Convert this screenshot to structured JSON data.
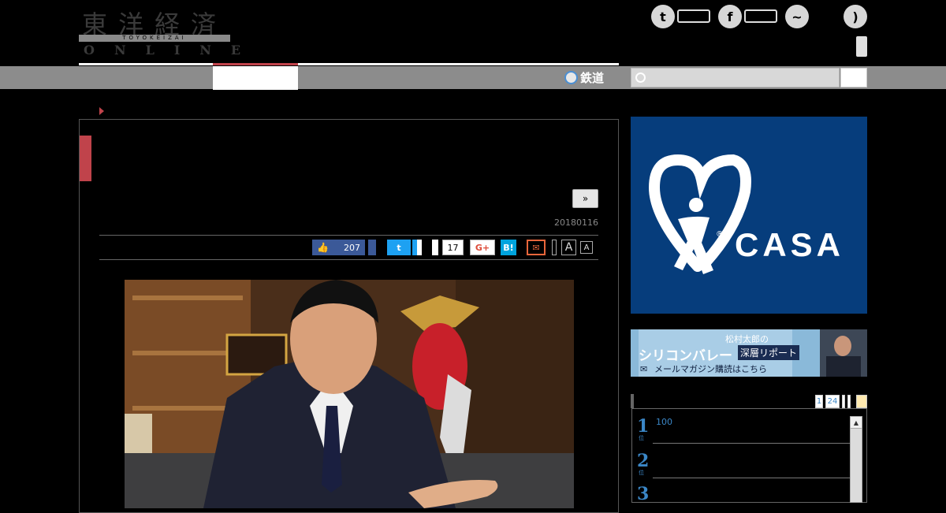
{
  "header": {
    "logo_kanji": "東洋経済",
    "logo_bar_text": "TOYOKEIZAI",
    "logo_online": "ONLINE",
    "social": [
      {
        "icon": "twitter-icon",
        "glyph": "t"
      },
      {
        "icon": "facebook-icon",
        "glyph": "f"
      },
      {
        "icon": "messenger-icon",
        "glyph": "~"
      },
      {
        "icon": "rss-icon",
        "glyph": ")"
      }
    ]
  },
  "nav": {
    "rail_label": "鉄道",
    "search_placeholder": ""
  },
  "article": {
    "next_label": "»",
    "date": "20180116",
    "share": {
      "like_count": "207",
      "share_count": "17",
      "gplus_label": "G+",
      "hatena_label": "B!",
      "font_large": "A",
      "font_small": "A"
    }
  },
  "sidebar": {
    "ad_text": "CASA",
    "ad_registered": "®",
    "banner": {
      "line1": "松村太郎の",
      "line2a": "シリコンバレー",
      "line2b": "深層リポート",
      "line3": "メールマガジン購読はこちら"
    },
    "ranking": {
      "pages": [
        "1",
        "24"
      ],
      "items": [
        {
          "rank": "1",
          "sub": "位",
          "text": "100"
        },
        {
          "rank": "2",
          "sub": "位",
          "text": ""
        },
        {
          "rank": "3",
          "sub": "位",
          "text": ""
        }
      ]
    }
  },
  "colors": {
    "accent_red": "#c0434b",
    "nav_gray": "#8c8c8c",
    "ad_blue": "#063d7c",
    "rank_blue": "#3b87c7"
  }
}
